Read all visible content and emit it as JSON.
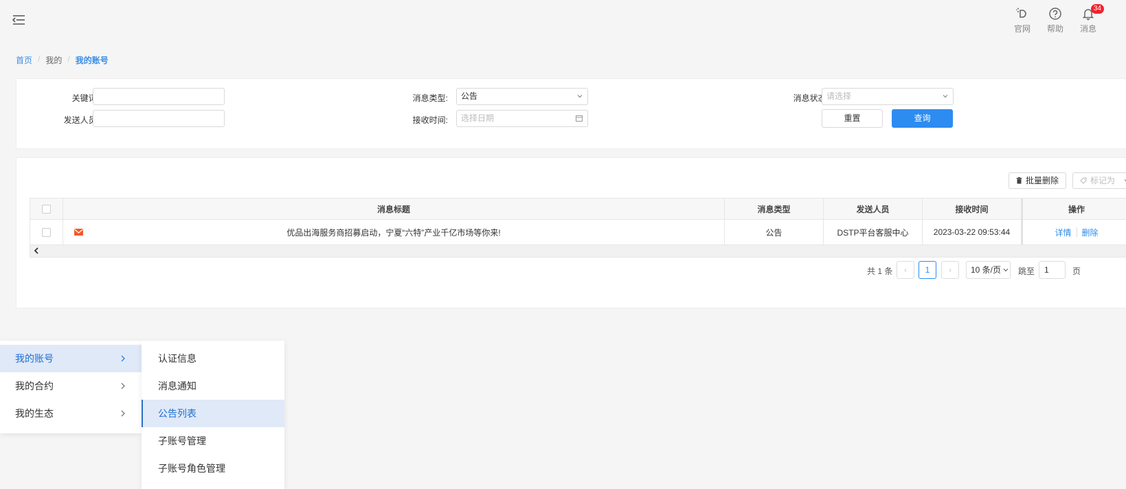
{
  "header": {
    "icons": [
      {
        "icon": "official-site-icon",
        "label": "官网"
      },
      {
        "icon": "help-icon",
        "label": "帮助"
      },
      {
        "icon": "bell-icon",
        "label": "消息",
        "badge": "34"
      }
    ]
  },
  "breadcrumb": [
    "首页",
    "我的",
    "我的账号"
  ],
  "filters": {
    "keyword_label": "关键词:",
    "keyword_value": "",
    "type_label": "消息类型:",
    "type_value": "公告",
    "status_label": "消息状态:",
    "status_placeholder": "请选择",
    "sender_label": "发送人员:",
    "sender_value": "",
    "time_label": "接收时间:",
    "time_placeholder": "选择日期",
    "reset_label": "重置",
    "query_label": "查询"
  },
  "toolbar": {
    "batch_delete_label": "批量删除",
    "mark_as_label": "标记为"
  },
  "table": {
    "headers": {
      "title": "消息标题",
      "type": "消息类型",
      "sender": "发送人员",
      "time": "接收时间",
      "actions": "操作"
    },
    "rows": [
      {
        "title": "优品出海服务商招募启动，宁夏“六特”产业千亿市场等你来!",
        "type": "公告",
        "sender": "DSTP平台客服中心",
        "time": "2023-03-22 09:53:44",
        "detail": "详情",
        "delete": "删除"
      }
    ]
  },
  "pagination": {
    "total": "共 1 条",
    "current": "1",
    "page_size": "10 条/页",
    "jump_label": "跳至",
    "jump_value": "1",
    "page_label": "页"
  },
  "menu_level1": [
    {
      "label": "我的账号",
      "active": true
    },
    {
      "label": "我的合约",
      "active": false
    },
    {
      "label": "我的生态",
      "active": false
    }
  ],
  "menu_level2": [
    {
      "label": "认证信息",
      "active": false
    },
    {
      "label": "消息通知",
      "active": false
    },
    {
      "label": "公告列表",
      "active": true
    },
    {
      "label": "子账号管理",
      "active": false
    },
    {
      "label": "子账号角色管理",
      "active": false
    }
  ],
  "colors": {
    "accent": "#2d8cf0",
    "badge": "#f5222d",
    "mail_icon": "#f5582a"
  }
}
